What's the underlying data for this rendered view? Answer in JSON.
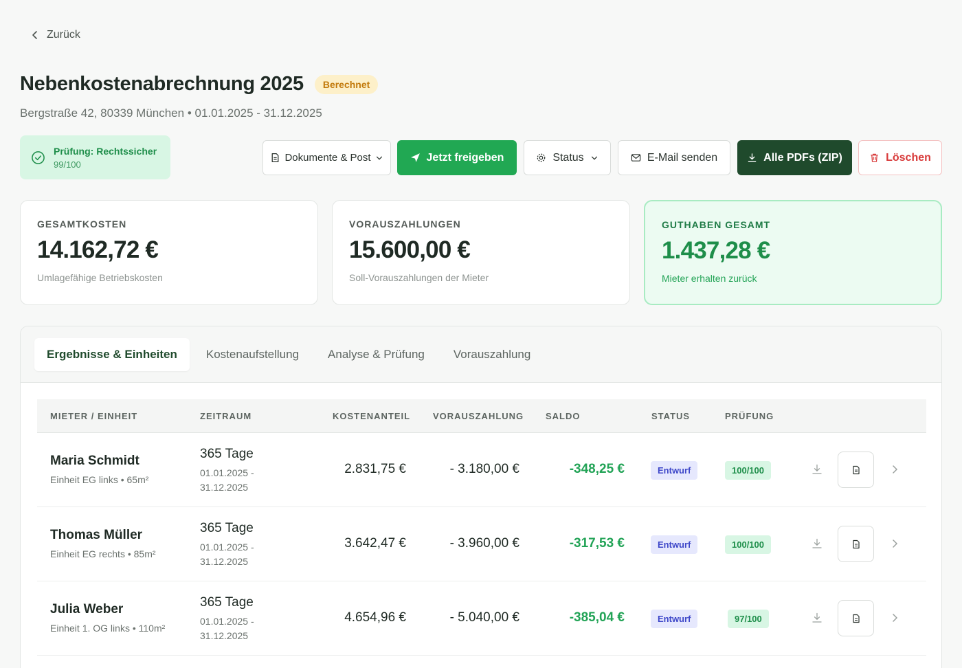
{
  "nav": {
    "back_label": "Zurück"
  },
  "header": {
    "title": "Nebenkostenabrechnung 2025",
    "status_badge": "Berechnet",
    "subtitle": "Bergstraße 42, 80339 München • 01.01.2025 - 31.12.2025"
  },
  "check": {
    "label": "Prüfung: Rechtssicher",
    "score": "99/100"
  },
  "toolbar": {
    "documents_label": "Dokumente & Post",
    "release_label": "Jetzt freigeben",
    "status_label": "Status",
    "email_label": "E-Mail senden",
    "zip_label": "Alle PDFs (ZIP)",
    "delete_label": "Löschen"
  },
  "summary": {
    "total": {
      "label": "GESAMTKOSTEN",
      "value": "14.162,72 €",
      "sub": "Umlagefähige Betriebskosten"
    },
    "prepay": {
      "label": "VORAUSZAHLUNGEN",
      "value": "15.600,00 €",
      "sub": "Soll-Vorauszahlungen der Mieter"
    },
    "credit": {
      "label": "GUTHABEN GESAMT",
      "value": "1.437,28 €",
      "sub": "Mieter erhalten zurück"
    }
  },
  "tabs": [
    {
      "label": "Ergebnisse & Einheiten"
    },
    {
      "label": "Kostenaufstellung"
    },
    {
      "label": "Analyse & Prüfung"
    },
    {
      "label": "Vorauszahlung"
    }
  ],
  "table": {
    "headers": [
      "MIETER / EINHEIT",
      "ZEITRAUM",
      "KOSTENANTEIL",
      "VORAUSZAHLUNG",
      "SALDO",
      "STATUS",
      "PRÜFUNG"
    ],
    "rows": [
      {
        "name": "Maria Schmidt",
        "unit": "Einheit EG links • 65m²",
        "days": "365 Tage",
        "from": "01.01.2025 -",
        "to": "31.12.2025",
        "cost": "2.831,75 €",
        "prepay": "- 3.180,00 €",
        "saldo": "-348,25 €",
        "status": "Entwurf",
        "check": "100/100"
      },
      {
        "name": "Thomas Müller",
        "unit": "Einheit EG rechts • 85m²",
        "days": "365 Tage",
        "from": "01.01.2025 -",
        "to": "31.12.2025",
        "cost": "3.642,47 €",
        "prepay": "- 3.960,00 €",
        "saldo": "-317,53 €",
        "status": "Entwurf",
        "check": "100/100"
      },
      {
        "name": "Julia Weber",
        "unit": "Einheit 1. OG links • 110m²",
        "days": "365 Tage",
        "from": "01.01.2025 -",
        "to": "31.12.2025",
        "cost": "4.654,96 €",
        "prepay": "- 5.040,00 €",
        "saldo": "-385,04 €",
        "status": "Entwurf",
        "check": "97/100"
      }
    ]
  },
  "colors": {
    "primary_green": "#21a853",
    "dark_green": "#1f4a2c",
    "danger": "#d83a3a",
    "warning_badge": "#fdf0c9",
    "draft_badge": "#e6e8fd"
  },
  "icons": {
    "back": "chevron-left-icon",
    "check": "check-circle-icon",
    "documents": "document-icon",
    "release": "send-icon",
    "status": "gear-icon",
    "email": "mail-icon",
    "zip": "download-icon",
    "delete": "trash-icon",
    "row_download": "download-icon",
    "row_document": "document-icon",
    "row_open": "chevron-right-icon"
  }
}
